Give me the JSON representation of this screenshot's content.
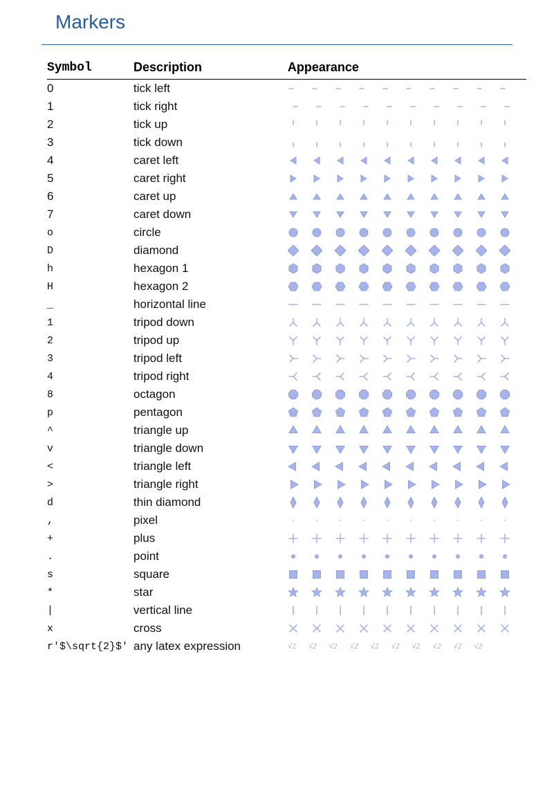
{
  "title": "Markers",
  "marker_color": "#a9b4e6",
  "marker_count": 10,
  "columns": {
    "symbol": "Symbol",
    "description": "Description",
    "appearance": "Appearance"
  },
  "rows": [
    {
      "symbol": "0",
      "big": true,
      "description": "tick left",
      "shape": "tickleft"
    },
    {
      "symbol": "1",
      "big": true,
      "description": "tick right",
      "shape": "tickright"
    },
    {
      "symbol": "2",
      "big": true,
      "description": "tick up",
      "shape": "tickup"
    },
    {
      "symbol": "3",
      "big": true,
      "description": "tick down",
      "shape": "tickdown"
    },
    {
      "symbol": "4",
      "big": true,
      "description": "caret left",
      "shape": "caretleft"
    },
    {
      "symbol": "5",
      "big": true,
      "description": "caret right",
      "shape": "caretright"
    },
    {
      "symbol": "6",
      "big": true,
      "description": "caret up",
      "shape": "caretup"
    },
    {
      "symbol": "7",
      "big": true,
      "description": "caret down",
      "shape": "caretdown"
    },
    {
      "symbol": "o",
      "big": false,
      "description": "circle",
      "shape": "circle"
    },
    {
      "symbol": "D",
      "big": false,
      "description": "diamond",
      "shape": "diamond"
    },
    {
      "symbol": "h",
      "big": false,
      "description": "hexagon 1",
      "shape": "hex1"
    },
    {
      "symbol": "H",
      "big": false,
      "description": "hexagon 2",
      "shape": "hex2"
    },
    {
      "symbol": "_",
      "big": false,
      "description": "horizontal line",
      "shape": "hline"
    },
    {
      "symbol": "1",
      "big": false,
      "description": "tripod down",
      "shape": "tridown"
    },
    {
      "symbol": "2",
      "big": false,
      "description": "tripod up",
      "shape": "triup"
    },
    {
      "symbol": "3",
      "big": false,
      "description": "tripod left",
      "shape": "trileft"
    },
    {
      "symbol": "4",
      "big": false,
      "description": "tripod right",
      "shape": "triright"
    },
    {
      "symbol": "8",
      "big": false,
      "description": "octagon",
      "shape": "octagon"
    },
    {
      "symbol": "p",
      "big": false,
      "description": "pentagon",
      "shape": "pentagon"
    },
    {
      "symbol": "^",
      "big": false,
      "description": "triangle up",
      "shape": "tup"
    },
    {
      "symbol": "v",
      "big": false,
      "description": "triangle down",
      "shape": "tdown"
    },
    {
      "symbol": "<",
      "big": false,
      "description": "triangle left",
      "shape": "tleft"
    },
    {
      "symbol": ">",
      "big": false,
      "description": "triangle right",
      "shape": "tright"
    },
    {
      "symbol": "d",
      "big": false,
      "description": "thin diamond",
      "shape": "thindiamond"
    },
    {
      "symbol": ",",
      "big": false,
      "description": "pixel",
      "shape": "pixel"
    },
    {
      "symbol": "+",
      "big": false,
      "description": "plus",
      "shape": "plus"
    },
    {
      "symbol": ".",
      "big": false,
      "description": "point",
      "shape": "point"
    },
    {
      "symbol": "s",
      "big": false,
      "description": "square",
      "shape": "square"
    },
    {
      "symbol": "*",
      "big": false,
      "description": "star",
      "shape": "star"
    },
    {
      "symbol": "|",
      "big": false,
      "description": "vertical line",
      "shape": "vline"
    },
    {
      "symbol": "x",
      "big": false,
      "description": "cross",
      "shape": "cross"
    },
    {
      "symbol": "r'$\\sqrt{2}$'",
      "big": false,
      "description": "any latex expression",
      "shape": "latex",
      "latex_text": "√2"
    }
  ]
}
